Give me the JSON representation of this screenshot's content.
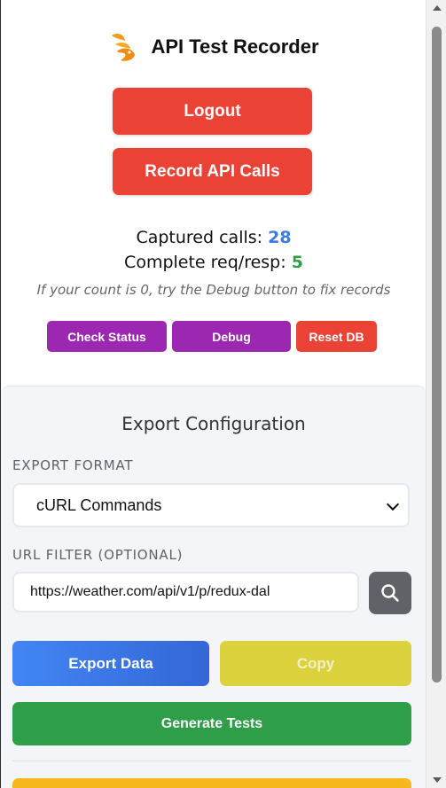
{
  "header": {
    "title": "API Test Recorder",
    "logo_icon": "rabbit-logo-icon"
  },
  "actions": {
    "logout_label": "Logout",
    "record_label": "Record API Calls"
  },
  "stats": {
    "captured_label": "Captured calls:",
    "captured_value": "28",
    "complete_label": "Complete req/resp:",
    "complete_value": "5",
    "hint": "If your count is 0, try the Debug button to fix records"
  },
  "tools": {
    "check_label": "Check Status",
    "debug_label": "Debug",
    "reset_label": "Reset DB"
  },
  "config": {
    "title": "Export Configuration",
    "format_label": "EXPORT FORMAT",
    "format_value": "cURL Commands",
    "filter_label": "URL FILTER (OPTIONAL)",
    "filter_value": "https://weather.com/api/v1/p/redux-dal",
    "export_label": "Export Data",
    "copy_label": "Copy",
    "generate_label": "Generate Tests"
  },
  "colors": {
    "red": "#ea4335",
    "purple": "#9c27b0",
    "blue": "#4285f4",
    "green": "#2e9e48",
    "yellow": "#dcd23e",
    "count_blue": "#3b7de0"
  }
}
